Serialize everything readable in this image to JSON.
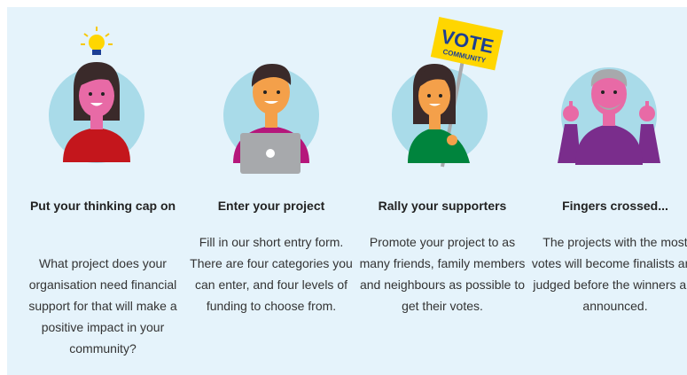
{
  "colors": {
    "panel_bg": "#e5f3fb",
    "circle": "#a9dbe9",
    "skin": "#f4a04a",
    "pink_skin": "#e86aa6",
    "red_top": "#c4161c",
    "magenta_top": "#b5177b",
    "green_top": "#00843d",
    "purple_top": "#7a2d8c",
    "sign_yellow": "#ffd600",
    "sign_blue": "#1d3f93"
  },
  "steps": [
    {
      "icon": "lightbulb-person-icon",
      "title": "Put your thinking cap on",
      "description": "What project does your organisation need financial support for that will make a positive impact in your community?"
    },
    {
      "icon": "laptop-person-icon",
      "title": "Enter your project",
      "description": "Fill in our short entry form. There are four categories you can enter, and four levels of funding to choose from."
    },
    {
      "icon": "vote-sign-person-icon",
      "title": "Rally your supporters",
      "description": "Promote your project to as many friends, family members and neighbours as possible to get their votes.",
      "sign_text": "VOTE",
      "sign_subtext": "COMMUNITY"
    },
    {
      "icon": "fingers-crossed-person-icon",
      "title": "Fingers crossed...",
      "description": "The projects with the most votes will become finalists and judged before the winners are announced."
    }
  ]
}
